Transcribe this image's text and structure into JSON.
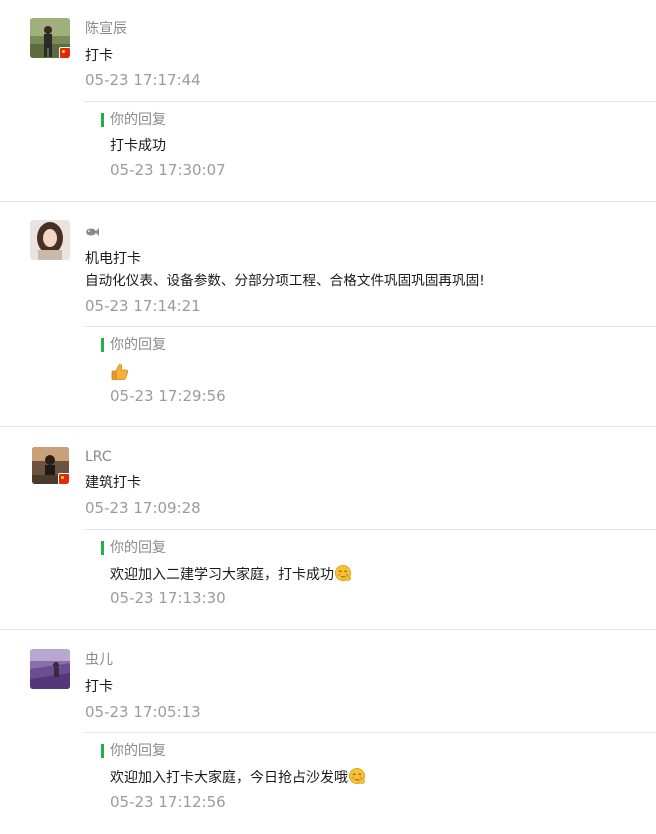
{
  "comments": [
    {
      "nickname": "陈宣辰",
      "text": "打卡",
      "time": "05-23 17:17:44",
      "reply_label": "你的回复",
      "reply_text": "打卡成功",
      "reply_time": "05-23 17:30:07",
      "has_flag": true
    },
    {
      "nickname": "",
      "text_line1": "机电打卡",
      "text_line2": "自动化仪表、设备参数、分部分项工程、合格文件巩固巩固再巩固!",
      "time": "05-23 17:14:21",
      "reply_label": "你的回复",
      "reply_emoji": "thumbs-up-icon",
      "reply_time": "05-23 17:29:56",
      "has_flag": false
    },
    {
      "nickname": "LRC",
      "text": "建筑打卡",
      "time": "05-23 17:09:28",
      "reply_label": "你的回复",
      "reply_text": "欢迎加入二建学习大家庭，打卡成功",
      "reply_emoji": "blush-face-icon",
      "reply_time": "05-23 17:13:30",
      "has_flag": true
    },
    {
      "nickname": "虫儿",
      "text": "打卡",
      "time": "05-23 17:05:13",
      "reply_label": "你的回复",
      "reply_text": "欢迎加入打卡大家庭，今日抢占沙发哦",
      "reply_emoji": "blush-face-icon",
      "reply_time": "05-23 17:12:56",
      "has_flag": false
    }
  ],
  "colors": {
    "accent_bar": "#21b04b",
    "muted_text": "#8a8a8a",
    "time_text": "#9b9b9b",
    "divider": "#e6e6e6"
  }
}
